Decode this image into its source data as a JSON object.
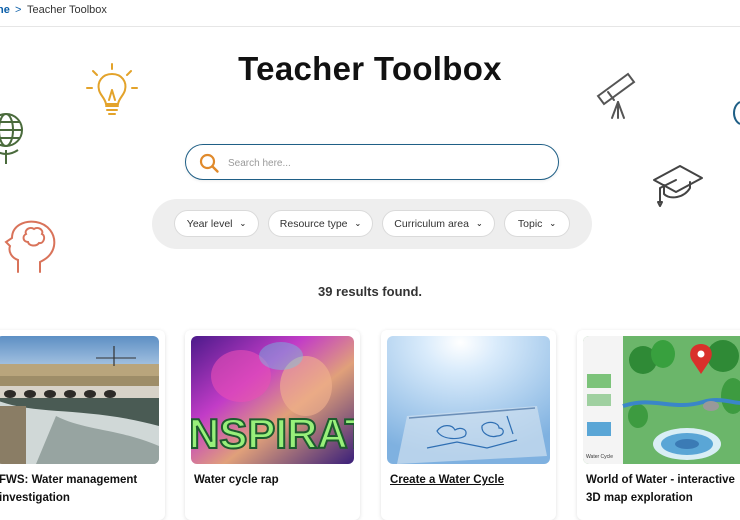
{
  "breadcrumb": {
    "home": "ne",
    "separator": ">",
    "current": "Teacher Toolbox"
  },
  "page": {
    "title": "Teacher Toolbox"
  },
  "search": {
    "placeholder": "Search here..."
  },
  "filters": [
    {
      "label": "Year level"
    },
    {
      "label": "Resource type"
    },
    {
      "label": "Curriculum area"
    },
    {
      "label": "Topic"
    }
  ],
  "results": {
    "text": "39 results found."
  },
  "cards": [
    {
      "title": "FWS: Water management investigation",
      "thumbnail": "dam-spillway-photo"
    },
    {
      "title": "Water cycle rap",
      "thumbnail": "colorful-inspiration-video-still",
      "thumb_text": "NSPIRAT"
    },
    {
      "title": "Create a Water Cycle",
      "thumbnail": "water-cycle-bag-photo"
    },
    {
      "title": "World of Water - interactive 3D map exploration",
      "thumbnail": "3d-map-illustration"
    }
  ],
  "colors": {
    "accent": "#1f5f86",
    "link": "#0a5ea8",
    "search_icon": "#e08a2c",
    "filter_bar": "#eeeeee"
  }
}
